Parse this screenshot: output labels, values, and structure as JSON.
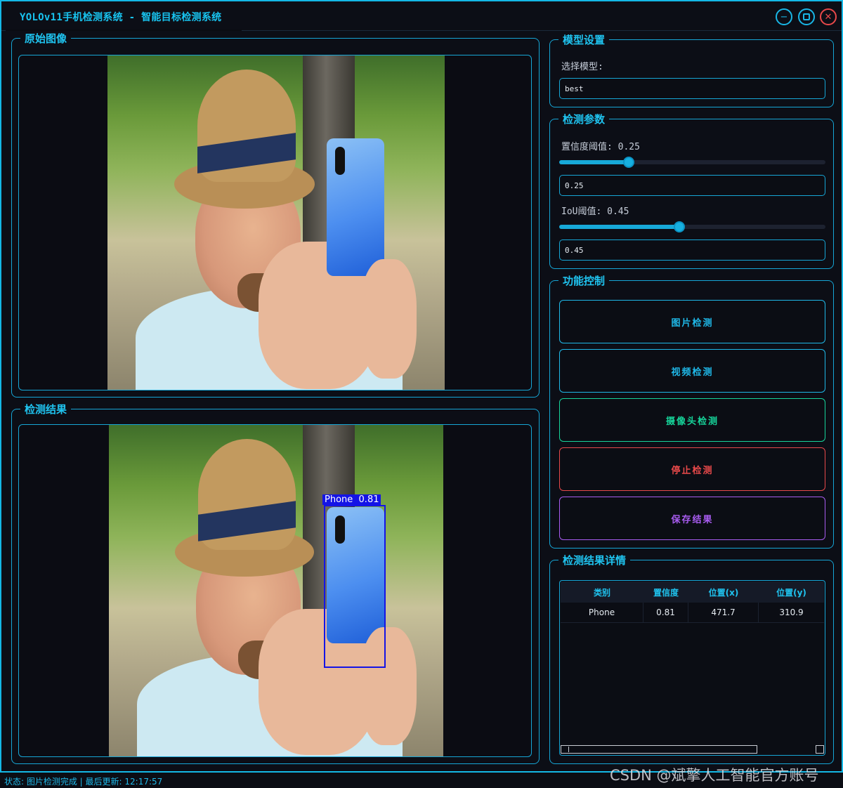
{
  "window": {
    "title": "YOLOv11手机检测系统 - 智能目标检测系统",
    "controls": [
      "minimize",
      "maximize",
      "close"
    ]
  },
  "original_panel": {
    "title": "原始图像"
  },
  "result_panel": {
    "title": "检测结果",
    "detection_label": "Phone  0.81"
  },
  "model_settings": {
    "title": "模型设置",
    "select_label": "选择模型:",
    "model_value": "best"
  },
  "detection_params": {
    "title": "检测参数",
    "conf_label": "置信度阈值: 0.25",
    "conf_slider": 0.25,
    "conf_value": "0.25",
    "iou_label": "IoU阈值: 0.45",
    "iou_slider": 0.45,
    "iou_value": "0.45"
  },
  "function_control": {
    "title": "功能控制",
    "image_detect": "图片检测",
    "video_detect": "视频检测",
    "camera_detect": "摄像头检测",
    "stop_detect": "停止检测",
    "save_result": "保存结果"
  },
  "details": {
    "title": "检测结果详情",
    "columns": [
      "类别",
      "置信度",
      "位置(x)",
      "位置(y)"
    ],
    "rows": [
      [
        "Phone",
        "0.81",
        "471.7",
        "310.9"
      ]
    ]
  },
  "status": {
    "text": "状态: 图片检测完成 | 最后更新: 12:17:57"
  },
  "watermark": "CSDN @斌擎人工智能官方账号",
  "colors": {
    "accent": "#18c4f0",
    "image_detect": "#1fb8e8",
    "video_detect": "#1fb8e8",
    "camera_detect": "#16d49a",
    "stop_detect": "#e8494a",
    "save_result": "#a85cf0",
    "detection_box": "#1414e6"
  }
}
